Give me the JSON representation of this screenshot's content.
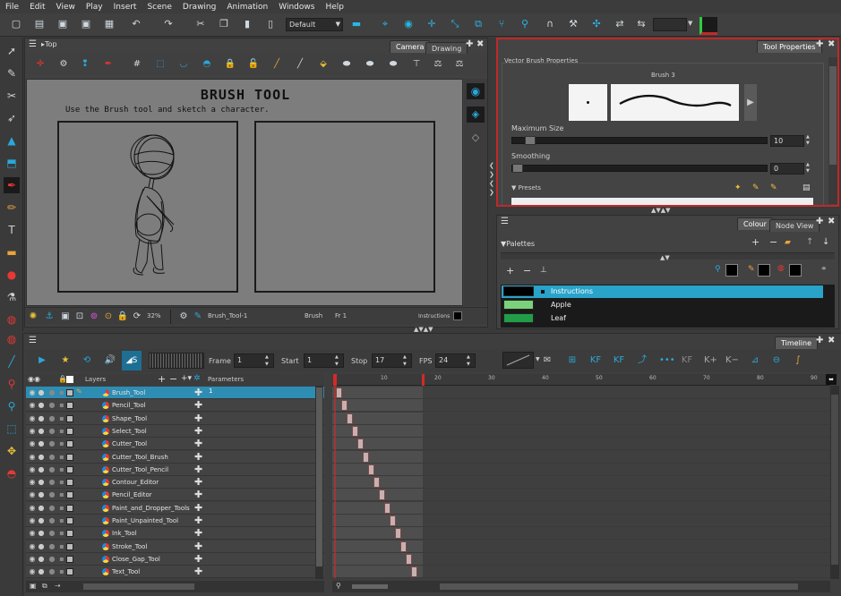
{
  "menu": [
    "File",
    "Edit",
    "View",
    "Play",
    "Insert",
    "Scene",
    "Drawing",
    "Animation",
    "Windows",
    "Help"
  ],
  "toolbar": {
    "workspace": "Default"
  },
  "camera_view": {
    "title": "Top",
    "tabs": [
      "Camera",
      "Drawing"
    ],
    "canvas_title": "BRUSH TOOL",
    "canvas_subtitle": "Use the Brush tool and sketch a character.",
    "status": {
      "zoom": "32%",
      "drawing": "Brush_Tool-1",
      "tool": "Brush",
      "frame": "Fr 1",
      "layer": "Instructions"
    }
  },
  "tool_properties": {
    "tab": "Tool Properties",
    "section": "Vector Brush Properties",
    "preset_name": "Brush 3",
    "max_size_label": "Maximum Size",
    "max_size_value": "10",
    "max_size_fraction": 0.05,
    "smoothing_label": "Smoothing",
    "smoothing_value": "0",
    "smoothing_fraction": 0.0,
    "presets_label": "Presets"
  },
  "colour": {
    "tabs": [
      "Colour",
      "Node View"
    ],
    "palettes_label": "Palettes",
    "swatches": [
      {
        "name": "Instructions",
        "color": "#000000",
        "selected": true
      },
      {
        "name": "Apple",
        "color": "#7bd17b",
        "selected": false
      },
      {
        "name": "Leaf",
        "color": "#239c48",
        "selected": false
      }
    ]
  },
  "timeline": {
    "tab": "Timeline",
    "frame_label": "Frame",
    "frame_value": "1",
    "start_label": "Start",
    "start_value": "1",
    "stop_label": "Stop",
    "stop_value": "17",
    "fps_label": "FPS",
    "fps_value": "24",
    "layers_header": "Layers",
    "parameters_header": "Parameters",
    "first_param": "1",
    "ruler": [
      "10",
      "20",
      "30",
      "40",
      "50",
      "60",
      "70",
      "80",
      "90"
    ],
    "layers": [
      "Brush_Tool",
      "Pencil_Tool",
      "Shape_Tool",
      "Select_Tool",
      "Cutter_Tool",
      "Cutter_Tool_Brush",
      "Cutter_Tool_Pencil",
      "Contour_Editor",
      "Pencil_Editor",
      "Paint_and_Dropper_Tools",
      "Paint_Unpainted_Tool",
      "Ink_Tool",
      "Stroke_Tool",
      "Close_Gap_Tool",
      "Text_Tool"
    ],
    "keyframe_layer_index": [
      0,
      1,
      2,
      3,
      4,
      5,
      6,
      7,
      8,
      9,
      10,
      11,
      12,
      13,
      14
    ]
  },
  "colors": {
    "accent": "#29a3c9",
    "highlight_border": "#c0282a",
    "playhead": "#d62828"
  }
}
